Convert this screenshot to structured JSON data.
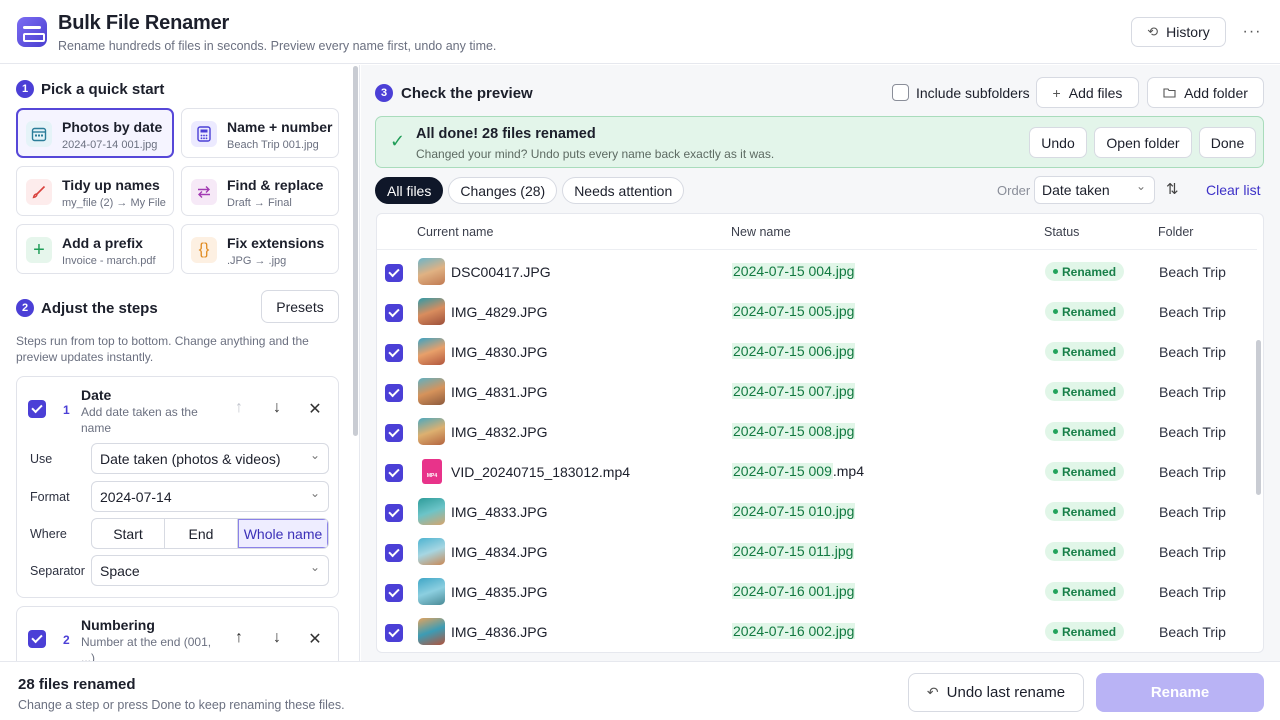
{
  "app": {
    "title": "Bulk File Renamer",
    "subtitle": "Rename hundreds of files in seconds. Preview every name first, undo any time.",
    "history_label": "History",
    "more_label": "···"
  },
  "quick_start": {
    "step": "1",
    "heading": "Pick a quick start",
    "cards": [
      {
        "title": "Photos by date",
        "sub": "2024-07-14 001.jpg",
        "icon": "calendar-icon",
        "selected": true
      },
      {
        "title": "Name + number",
        "sub": "Beach Trip 001.jpg",
        "icon": "calculator-icon"
      },
      {
        "title": "Tidy up names",
        "sub": "my_file (2) → My File",
        "icon": "brush-icon"
      },
      {
        "title": "Find & replace",
        "sub": "Draft → Final",
        "icon": "swap-icon"
      },
      {
        "title": "Add a prefix",
        "sub": "Invoice - march.pdf",
        "icon": "plus-icon"
      },
      {
        "title": "Fix extensions",
        "sub": ".JPG → .jpg",
        "icon": "braces-icon"
      }
    ]
  },
  "adjust": {
    "step": "2",
    "heading": "Adjust the steps",
    "presets_label": "Presets",
    "description": "Steps run from top to bottom. Change anything and the preview updates instantly.",
    "steps": [
      {
        "index": "1",
        "title": "Date",
        "desc": "Add date taken as the name",
        "fields": {
          "use_label": "Use",
          "use_value": "Date taken (photos & videos)",
          "format_label": "Format",
          "format_value": "2024-07-14",
          "where_label": "Where",
          "where_options": [
            "Start",
            "End",
            "Whole name"
          ],
          "where_selected": "Whole name",
          "separator_label": "Separator",
          "separator_value": "Space"
        }
      },
      {
        "index": "2",
        "title": "Numbering",
        "desc": "Number at the end (001, ...)"
      }
    ]
  },
  "preview": {
    "step": "3",
    "heading": "Check the preview",
    "include_subfolders_label": "Include subfolders",
    "include_subfolders_checked": false,
    "add_files_label": "Add files",
    "add_folder_label": "Add folder",
    "banner": {
      "title": "All done! 28 files renamed",
      "subtitle": "Changed your mind? Undo puts every name back exactly as it was.",
      "undo_label": "Undo",
      "open_folder_label": "Open folder",
      "done_label": "Done"
    },
    "tabs": [
      "All files",
      "Changes (28)",
      "Needs attention"
    ],
    "active_tab": "All files",
    "order_label": "Order",
    "order_value": "Date taken",
    "clear_label": "Clear list",
    "columns": [
      "Current name",
      "New name",
      "Status",
      "Folder"
    ],
    "rows": [
      {
        "current": "DSC00417.JPG",
        "new_hl": "2024-07-15 004.jpg",
        "new_rest": "",
        "status": "Renamed",
        "folder": "Beach Trip",
        "type": "image",
        "colors": [
          "#6bb4c9",
          "#e0b283",
          "#c07a52"
        ]
      },
      {
        "current": "IMG_4829.JPG",
        "new_hl": "2024-07-15 005.jpg",
        "new_rest": "",
        "status": "Renamed",
        "folder": "Beach Trip",
        "type": "image",
        "colors": [
          "#2f9aa8",
          "#d98d5e",
          "#9c4f3a"
        ]
      },
      {
        "current": "IMG_4830.JPG",
        "new_hl": "2024-07-15 006.jpg",
        "new_rest": "",
        "status": "Renamed",
        "folder": "Beach Trip",
        "type": "image",
        "colors": [
          "#3aa3c4",
          "#e8a06a",
          "#b1563d"
        ]
      },
      {
        "current": "IMG_4831.JPG",
        "new_hl": "2024-07-15 007.jpg",
        "new_rest": "",
        "status": "Renamed",
        "folder": "Beach Trip",
        "type": "image",
        "colors": [
          "#5fb0c2",
          "#d6935b",
          "#8c5a3c"
        ]
      },
      {
        "current": "IMG_4832.JPG",
        "new_hl": "2024-07-15 008.jpg",
        "new_rest": "",
        "status": "Renamed",
        "folder": "Beach Trip",
        "type": "image",
        "colors": [
          "#4ba8bf",
          "#ddb070",
          "#b3643f"
        ]
      },
      {
        "current": "VID_20240715_183012.mp4",
        "new_hl": "2024-07-15 009",
        "new_rest": ".mp4",
        "status": "Renamed",
        "folder": "Beach Trip",
        "type": "video",
        "type_label": "MP4"
      },
      {
        "current": "IMG_4833.JPG",
        "new_hl": "2024-07-15 010.jpg",
        "new_rest": "",
        "status": "Renamed",
        "folder": "Beach Trip",
        "type": "image",
        "colors": [
          "#2e9c9a",
          "#6cc4c8",
          "#d7a46c"
        ]
      },
      {
        "current": "IMG_4834.JPG",
        "new_hl": "2024-07-15 011.jpg",
        "new_rest": "",
        "status": "Renamed",
        "folder": "Beach Trip",
        "type": "image",
        "colors": [
          "#4db3d0",
          "#a6d6e2",
          "#c98855"
        ]
      },
      {
        "current": "IMG_4835.JPG",
        "new_hl": "2024-07-16 001.jpg",
        "new_rest": "",
        "status": "Renamed",
        "folder": "Beach Trip",
        "type": "image",
        "colors": [
          "#3fa6c6",
          "#8ccfe0",
          "#4a8a96"
        ]
      },
      {
        "current": "IMG_4836.JPG",
        "new_hl": "2024-07-16 002.jpg",
        "new_rest": "",
        "status": "Renamed",
        "folder": "Beach Trip",
        "type": "image",
        "colors": [
          "#e2a35e",
          "#3c9cb5",
          "#b2533b"
        ]
      }
    ]
  },
  "footer": {
    "title": "28 files renamed",
    "subtitle": "Change a step or press Done to keep renaming these files.",
    "undo_last_label": "Undo last rename",
    "rename_label": "Rename"
  },
  "colors": {
    "accent": "#4b3fd6",
    "success": "#1f9d57",
    "rename_disabled": "#b9b3f5"
  }
}
